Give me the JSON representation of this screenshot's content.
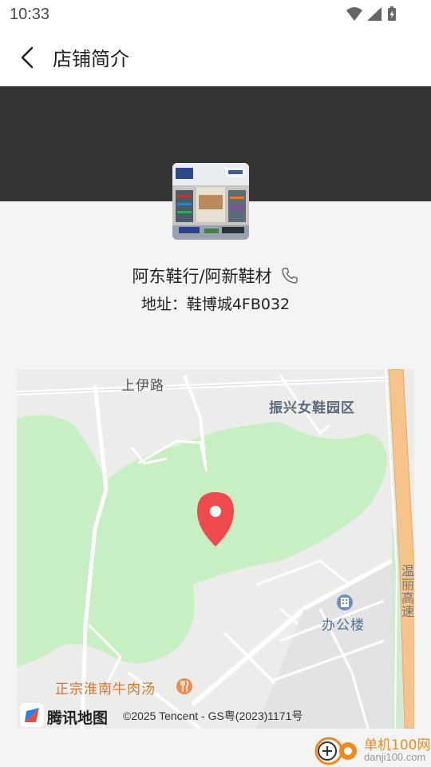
{
  "status_bar": {
    "time": "10:33"
  },
  "header": {
    "title": "店铺简介"
  },
  "store": {
    "name": "阿东鞋行/阿新鞋材",
    "address": "地址：鞋博城4FB032"
  },
  "map": {
    "labels": {
      "road_north": "上伊路",
      "park_area": "振兴女鞋园区",
      "office": "办公楼",
      "restaurant": "正宗淮南牛肉汤",
      "highway": "温丽高速"
    },
    "logo_text": "腾讯地图",
    "copyright": "©2025 Tencent - GS粤(2023)1171号",
    "colors": {
      "green_area": "#c8efc4",
      "highway": "#f6c48a",
      "marker": "#ef4b4f"
    }
  },
  "watermark": {
    "cn": "单机100网",
    "en": "danji100.com"
  }
}
